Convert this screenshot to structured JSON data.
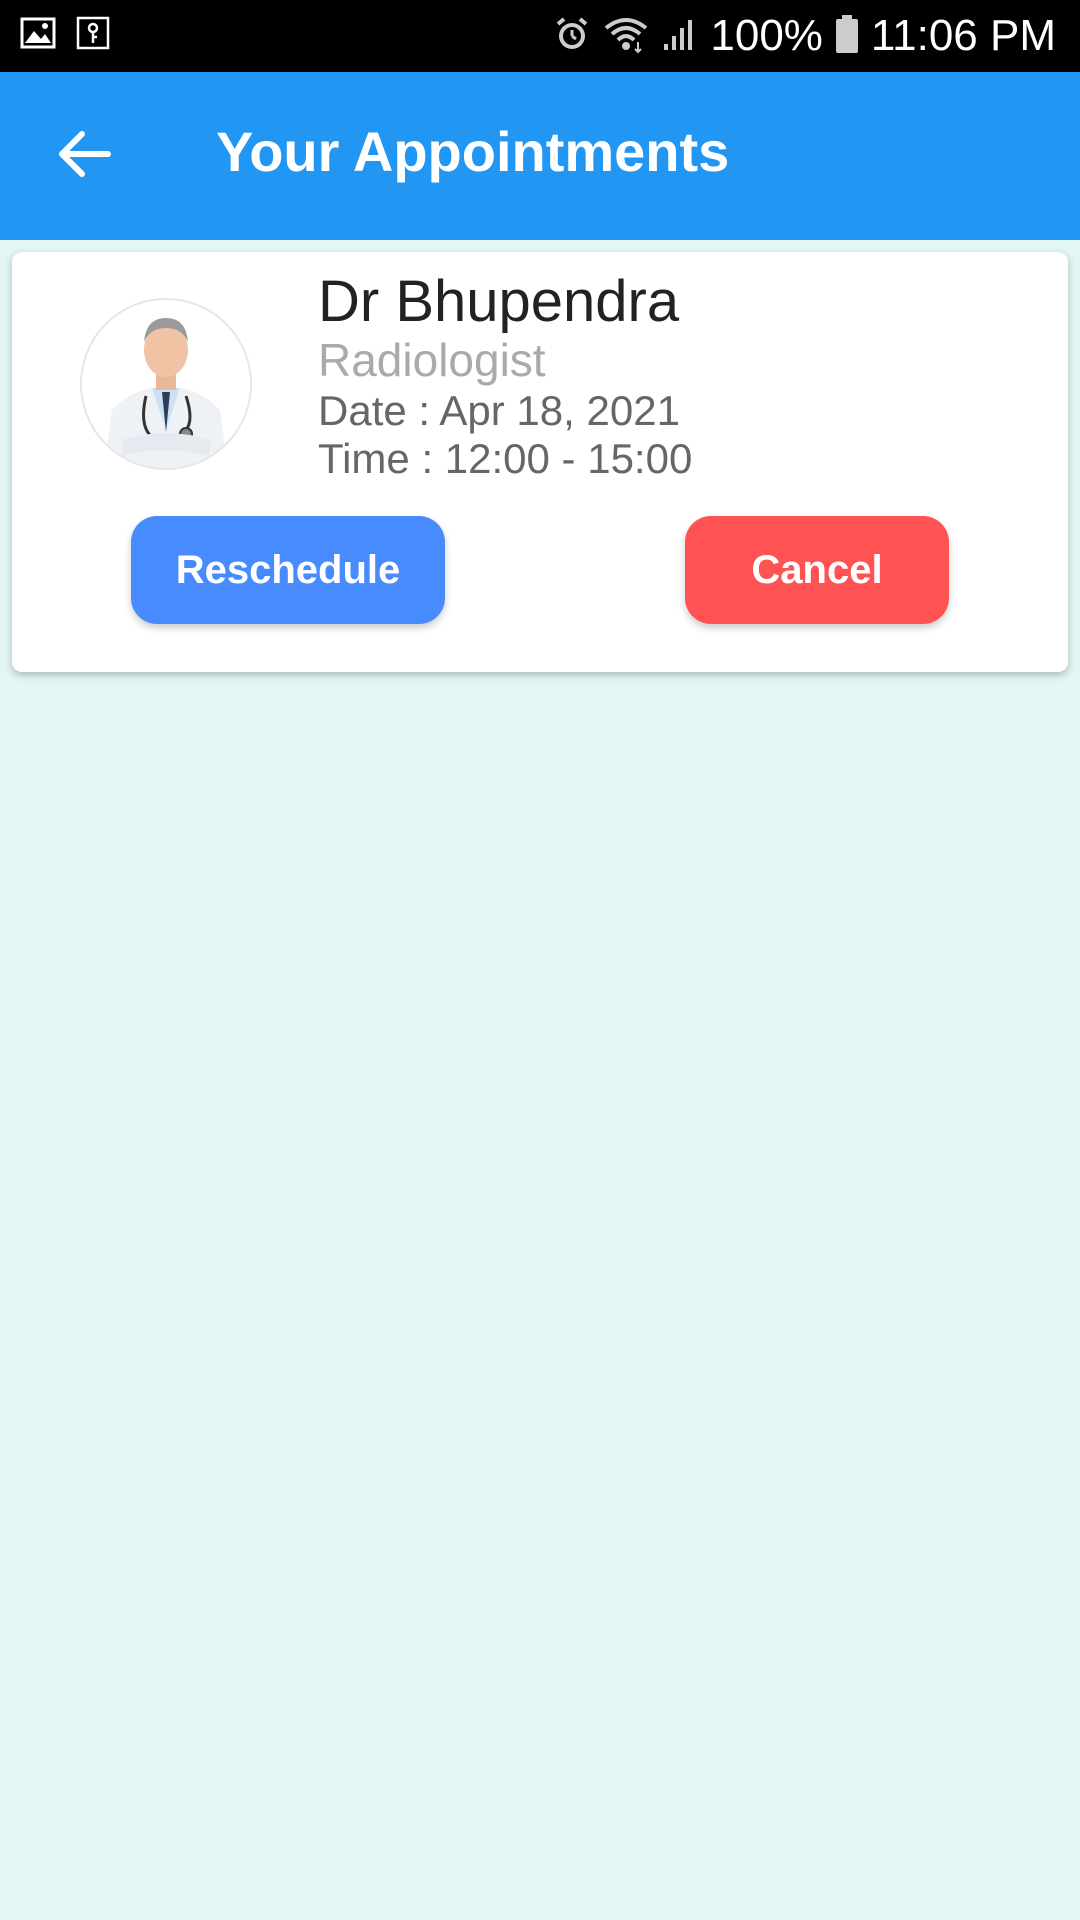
{
  "status_bar": {
    "battery": "100%",
    "time": "11:06 PM",
    "icons": [
      "gallery-icon",
      "key-icon",
      "alarm-icon",
      "wifi-icon",
      "signal-icon",
      "battery-icon"
    ]
  },
  "app_bar": {
    "title": "Your Appointments",
    "back_icon": "arrow-left-icon",
    "color": "#2196f3"
  },
  "appointment": {
    "doctor_name": "Dr Bhupendra",
    "specialty": "Radiologist",
    "date": "Date : Apr 18, 2021",
    "time": "Time : 12:00 - 15:00",
    "reschedule_label": "Reschedule",
    "cancel_label": "Cancel",
    "reschedule_color": "#478bff",
    "cancel_color": "#ff5252"
  },
  "background_color": "#e2f6f5"
}
